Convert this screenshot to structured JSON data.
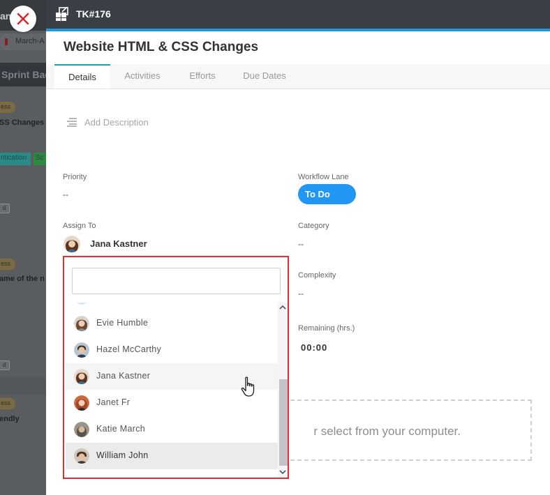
{
  "background": {
    "header_text": "an",
    "sprint_text": "March-A",
    "backlog_text": "Sprint Back",
    "cards": [
      {
        "pill": "ess",
        "title": "SS Changes"
      },
      {
        "pill": "ess",
        "title": "ame of the n"
      },
      {
        "pill": "ess",
        "title": "endly"
      }
    ],
    "tags": [
      "ntication",
      "Sc"
    ],
    "box_label": "d"
  },
  "panel": {
    "task_id": "TK#176",
    "title": "Website HTML & CSS Changes",
    "tabs": [
      {
        "label": "Details",
        "active": true
      },
      {
        "label": "Activities",
        "active": false
      },
      {
        "label": "Efforts",
        "active": false
      },
      {
        "label": "Due Dates",
        "active": false
      }
    ],
    "description_placeholder": "Add Description",
    "fields": {
      "priority_label": "Priority",
      "priority_value": "--",
      "workflow_label": "Workflow Lane",
      "workflow_value": "To Do",
      "assign_label": "Assign To",
      "assign_value": "Jana Kastner",
      "category_label": "Category",
      "category_value": "--",
      "complexity_label": "Complexity",
      "complexity_value": "--",
      "remaining_label": "Remaining (hrs.)",
      "remaining_value": "00:00"
    },
    "dropzone_text": "r select from your computer.",
    "colors": {
      "header": "#3a3f45",
      "accent": "#1e9be0",
      "lane_pill": "#2196f3",
      "dropdown_border": "#e0302e",
      "active_tab": "#1aa3a0"
    }
  },
  "dropdown": {
    "search_value": "",
    "items": [
      {
        "name": "",
        "partial": true
      },
      {
        "name": "Evie Humble"
      },
      {
        "name": "Hazel McCarthy"
      },
      {
        "name": "Jana Kastner",
        "hover": true
      },
      {
        "name": "Janet Fr"
      },
      {
        "name": "Katie March"
      },
      {
        "name": "William John",
        "selected": true
      }
    ]
  },
  "icons": {
    "close": "close-icon",
    "task": "task-icon",
    "description": "description-lines-icon",
    "cursor": "hand-pointer-icon",
    "scroll_up": "chevron-up-icon",
    "scroll_down": "chevron-down-icon"
  }
}
